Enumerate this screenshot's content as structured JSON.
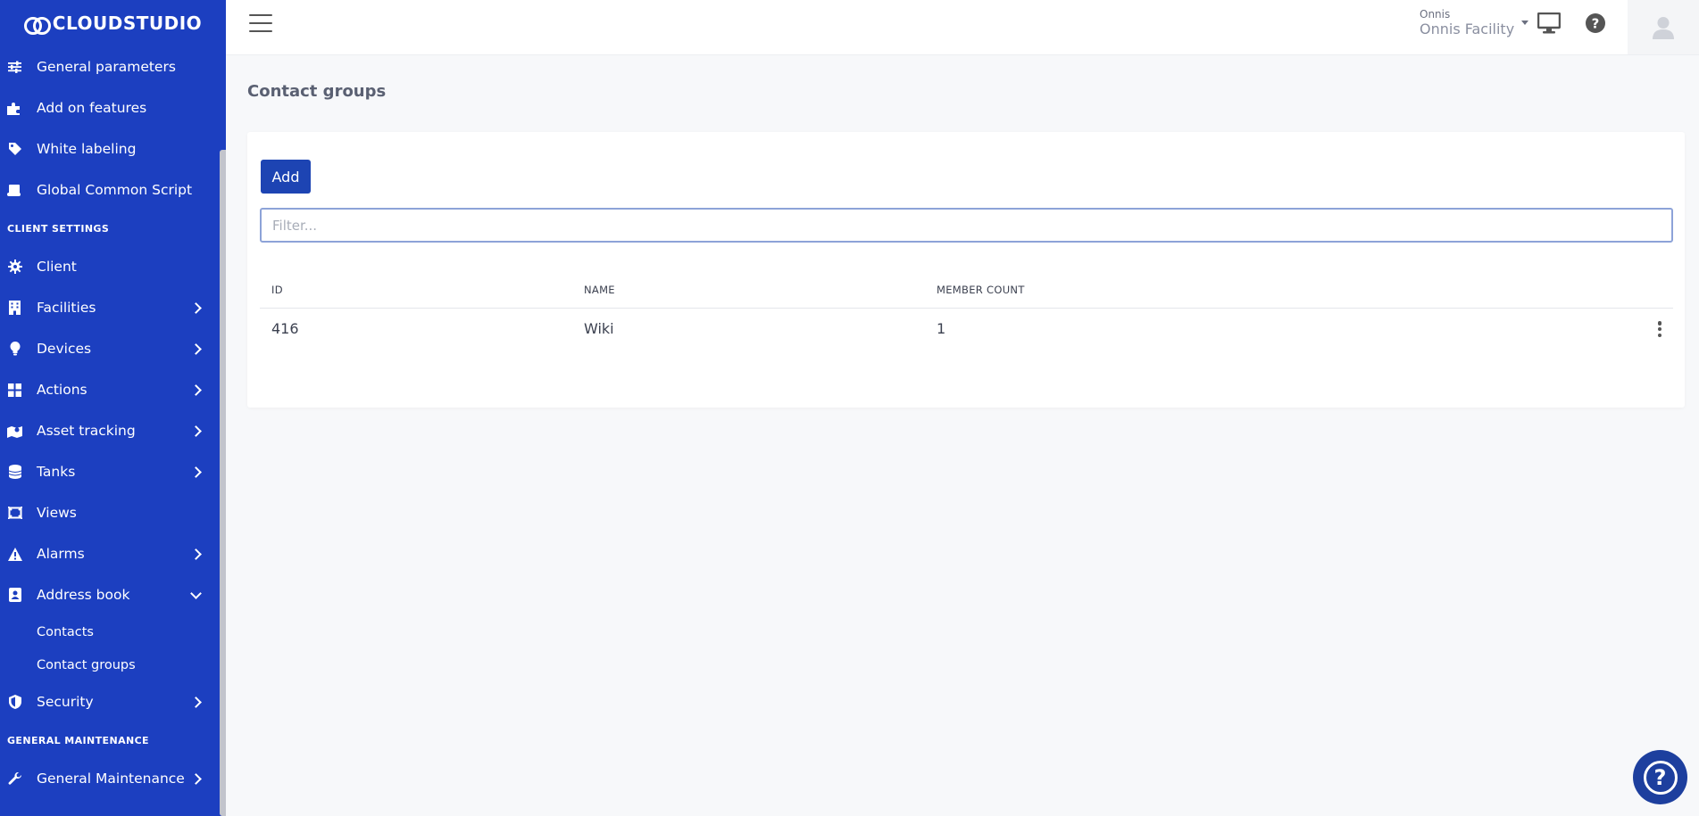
{
  "brand": {
    "name": "CLOUDSTUDIO"
  },
  "sidebar": {
    "top_items": [
      {
        "label": "General parameters",
        "icon": "sliders-icon"
      },
      {
        "label": "Add on features",
        "icon": "puzzle-icon"
      },
      {
        "label": "White labeling",
        "icon": "tag-icon"
      },
      {
        "label": "Global Common Script",
        "icon": "scroll-icon"
      }
    ],
    "client_settings_header": "CLIENT SETTINGS",
    "client_items": [
      {
        "label": "Client",
        "icon": "gear-icon"
      },
      {
        "label": "Facilities",
        "icon": "building-icon"
      },
      {
        "label": "Devices",
        "icon": "bulb-icon"
      },
      {
        "label": "Actions",
        "icon": "grid-icon"
      },
      {
        "label": "Asset tracking",
        "icon": "map-marker-icon"
      },
      {
        "label": "Tanks",
        "icon": "database-icon"
      },
      {
        "label": "Views",
        "icon": "frame-icon"
      },
      {
        "label": "Alarms",
        "icon": "warning-icon"
      },
      {
        "label": "Address book",
        "icon": "address-book-icon"
      }
    ],
    "address_book_sub": [
      "Contacts",
      "Contact groups"
    ],
    "security": {
      "label": "Security",
      "icon": "shield-icon"
    },
    "general_maintenance_header": "GENERAL MAINTENANCE",
    "general_maintenance": {
      "label": "General Maintenance",
      "icon": "wrench-icon"
    }
  },
  "topbar": {
    "user_small": "Onnis",
    "user_facility": "Onnis Facility"
  },
  "page": {
    "title": "Contact groups",
    "add_label": "Add",
    "filter_placeholder": "Filter...",
    "columns": {
      "id": "ID",
      "name": "NAME",
      "member_count": "MEMBER COUNT"
    },
    "rows": [
      {
        "id": "416",
        "name": "Wiki",
        "member_count": "1"
      }
    ]
  },
  "colors": {
    "sidebar": "#1c3fc0",
    "primary_button": "#1d44b3",
    "fab": "#1d3f9e"
  }
}
